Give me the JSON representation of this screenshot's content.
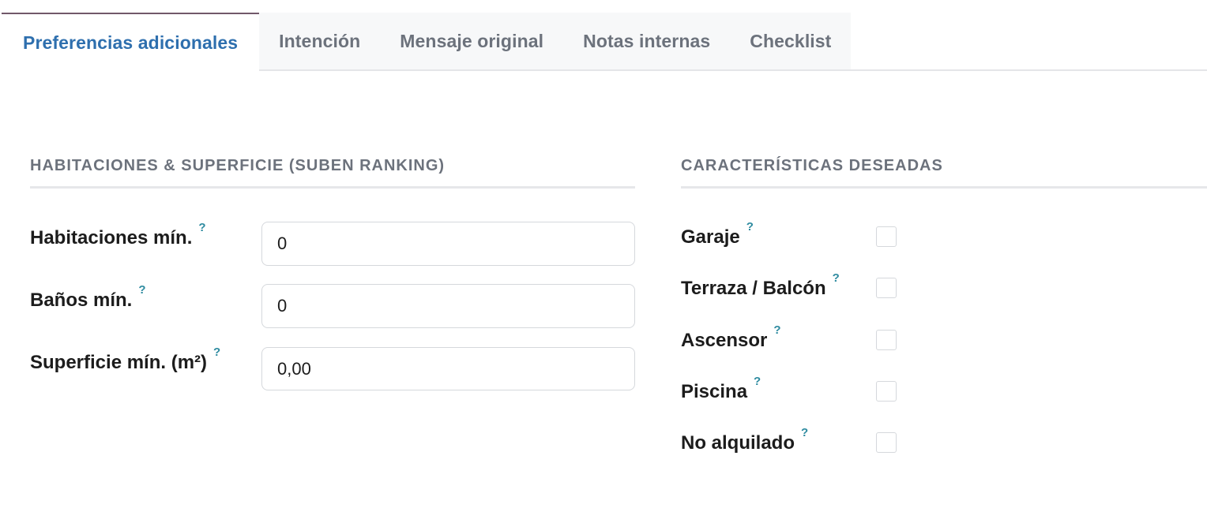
{
  "tabs": [
    {
      "label": "Preferencias adicionales",
      "active": true
    },
    {
      "label": "Intención",
      "active": false
    },
    {
      "label": "Mensaje original",
      "active": false
    },
    {
      "label": "Notas internas",
      "active": false
    },
    {
      "label": "Checklist",
      "active": false
    }
  ],
  "rooms_section": {
    "title": "HABITACIONES & SUPERFICIE (SUBEN RANKING)",
    "fields": [
      {
        "label": "Habitaciones mín.",
        "help": "?",
        "value": "0"
      },
      {
        "label": "Baños mín.",
        "help": "?",
        "value": "0"
      },
      {
        "label": "Superficie mín. (m²)",
        "help": "?",
        "value": "0,00"
      }
    ]
  },
  "features_section": {
    "title": "CARACTERÍSTICAS DESEADAS",
    "fields": [
      {
        "label": "Garaje",
        "help": "?",
        "checked": false
      },
      {
        "label": "Terraza / Balcón",
        "help": "?",
        "checked": false
      },
      {
        "label": "Ascensor",
        "help": "?",
        "checked": false
      },
      {
        "label": "Piscina",
        "help": "?",
        "checked": false
      },
      {
        "label": "No alquilado",
        "help": "?",
        "checked": false
      }
    ]
  },
  "colors": {
    "active_tab_text": "#2e6fae",
    "active_tab_top_border": "#71586a",
    "inactive_tab_text": "#6c727c",
    "inactive_tab_bg": "#f7f8f9",
    "help_marker": "#2e8ba0",
    "section_title": "#6c727c"
  }
}
